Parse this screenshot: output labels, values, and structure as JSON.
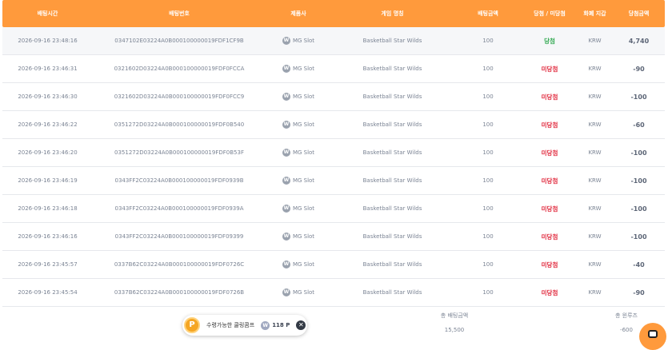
{
  "headers": [
    "배팅시간",
    "배팅번호",
    "제품사",
    "게임 명칭",
    "배팅금액",
    "당첨 / 미당첨",
    "화폐 지갑",
    "당첨금액"
  ],
  "rows": [
    {
      "time": "2026-09-16 23:48:16",
      "bet_id": "0347102E03224A0B000100000019FDF1CF9B",
      "provider": "MG Slot",
      "game": "Basketball Star Wilds",
      "amount": "100",
      "result": "당첨",
      "currency": "KRW",
      "payout": "4,740"
    },
    {
      "time": "2026-09-16 23:46:31",
      "bet_id": "0321602D03224A0B000100000019FDF0FCCA",
      "provider": "MG Slot",
      "game": "Basketball Star Wilds",
      "amount": "100",
      "result": "미당첨",
      "currency": "KRW",
      "payout": "-90"
    },
    {
      "time": "2026-09-16 23:46:30",
      "bet_id": "0321602D03224A0B000100000019FDF0FCC9",
      "provider": "MG Slot",
      "game": "Basketball Star Wilds",
      "amount": "100",
      "result": "미당첨",
      "currency": "KRW",
      "payout": "-100"
    },
    {
      "time": "2026-09-16 23:46:22",
      "bet_id": "0351272D03224A0B000100000019FDF0B540",
      "provider": "MG Slot",
      "game": "Basketball Star Wilds",
      "amount": "100",
      "result": "미당첨",
      "currency": "KRW",
      "payout": "-60"
    },
    {
      "time": "2026-09-16 23:46:20",
      "bet_id": "0351272D03224A0B000100000019FDF0B53F",
      "provider": "MG Slot",
      "game": "Basketball Star Wilds",
      "amount": "100",
      "result": "미당첨",
      "currency": "KRW",
      "payout": "-100"
    },
    {
      "time": "2026-09-16 23:46:19",
      "bet_id": "0343FF2C03224A0B000100000019FDF0939B",
      "provider": "MG Slot",
      "game": "Basketball Star Wilds",
      "amount": "100",
      "result": "미당첨",
      "currency": "KRW",
      "payout": "-100"
    },
    {
      "time": "2026-09-16 23:46:18",
      "bet_id": "0343FF2C03224A0B000100000019FDF0939A",
      "provider": "MG Slot",
      "game": "Basketball Star Wilds",
      "amount": "100",
      "result": "미당첨",
      "currency": "KRW",
      "payout": "-100"
    },
    {
      "time": "2026-09-16 23:46:16",
      "bet_id": "0343FF2C03224A0B000100000019FDF09399",
      "provider": "MG Slot",
      "game": "Basketball Star Wilds",
      "amount": "100",
      "result": "미당첨",
      "currency": "KRW",
      "payout": "-100"
    },
    {
      "time": "2026-09-16 23:45:57",
      "bet_id": "0337B62C03224A0B000100000019FDF0726C",
      "provider": "MG Slot",
      "game": "Basketball Star Wilds",
      "amount": "100",
      "result": "미당첨",
      "currency": "KRW",
      "payout": "-40"
    },
    {
      "time": "2026-09-16 23:45:54",
      "bet_id": "0337B62C03224A0B000100000019FDF0726B",
      "provider": "MG Slot",
      "game": "Basketball Star Wilds",
      "amount": "100",
      "result": "미당첨",
      "currency": "KRW",
      "payout": "-90"
    }
  ],
  "summary": {
    "total_bet_label": "총 배팅금액",
    "total_bet_value": "15,500",
    "total_win_label": "총 윈루즈",
    "total_win_value": "-600"
  },
  "promo": {
    "coin_letter": "P",
    "text": "수령가능한 쿨링콤프",
    "points_icon_letter": "W",
    "points": "118 P",
    "close_glyph": "✕"
  },
  "icons": {
    "provider_icon": "mg-slot-logo-icon",
    "chat_icon": "chat-bubble-icon"
  },
  "colors": {
    "header_bg": "#ff9a3c",
    "win": "#2fa84f",
    "lose": "#e0263a"
  }
}
